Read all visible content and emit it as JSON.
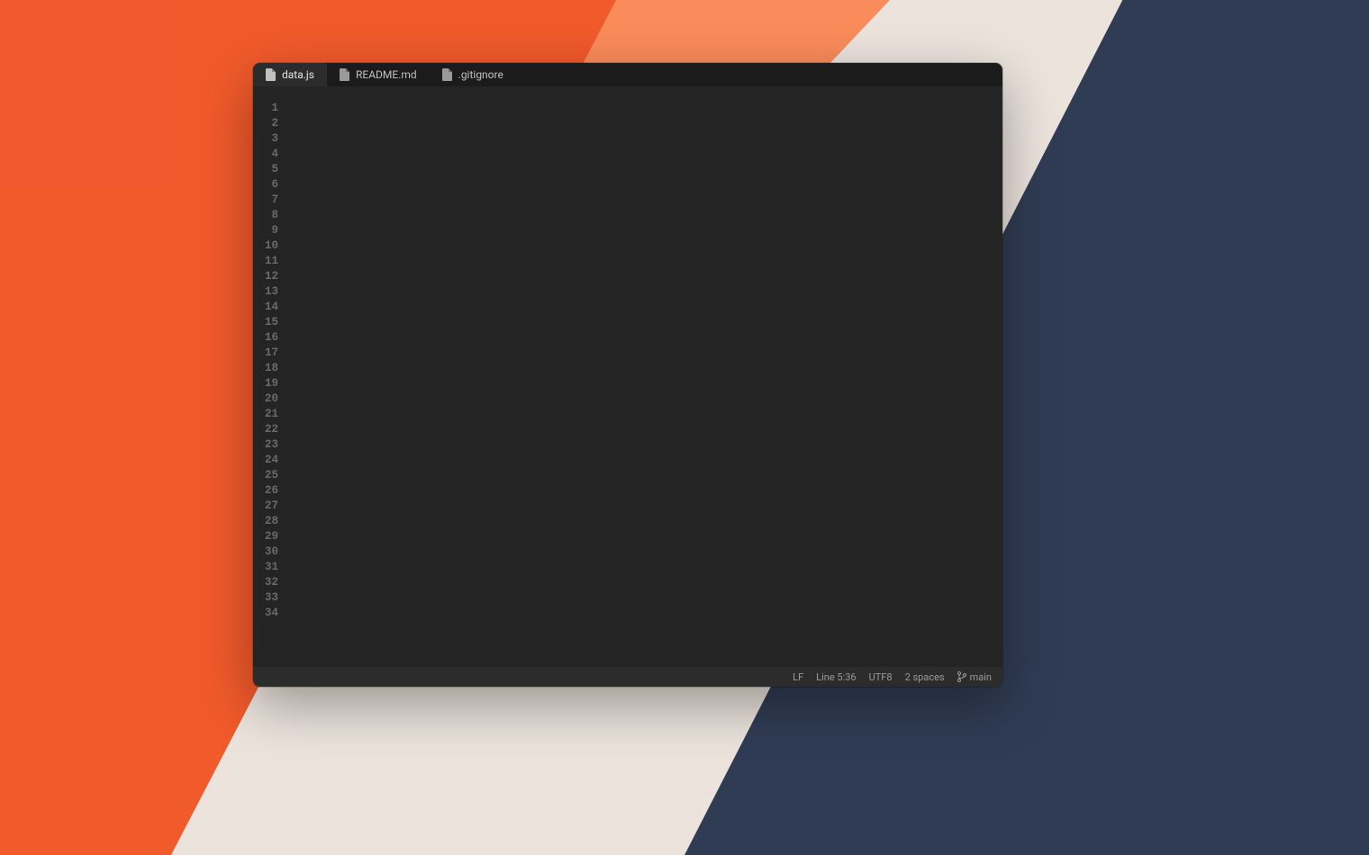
{
  "tabs": [
    {
      "label": "data.js",
      "active": true
    },
    {
      "label": "README.md",
      "active": false
    },
    {
      "label": ".gitignore",
      "active": false
    }
  ],
  "line_count": 34,
  "status": {
    "eol": "LF",
    "cursor": "Line 5:36",
    "encoding": "UTF8",
    "indent": "2 spaces",
    "branch": "main"
  },
  "colors": {
    "navy": "#2f3c53",
    "cream": "#ebe3dc",
    "peach": "#fa8b5a",
    "orange": "#f15a2b",
    "editor_bg": "#242424"
  }
}
